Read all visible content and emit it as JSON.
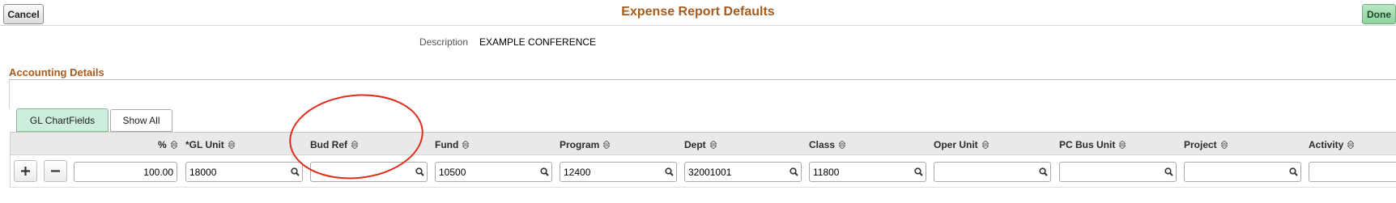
{
  "header": {
    "cancel_label": "Cancel",
    "title": "Expense Report Defaults",
    "done_label": "Done"
  },
  "description": {
    "label": "Description",
    "value": "EXAMPLE CONFERENCE"
  },
  "accounting": {
    "section_title": "Accounting Details",
    "tabs": [
      {
        "label": "GL ChartFields",
        "active": true
      },
      {
        "label": "Show All",
        "active": false
      }
    ],
    "columns": [
      "%",
      "*GL Unit",
      "Bud Ref",
      "Fund",
      "Program",
      "Dept",
      "Class",
      "Oper Unit",
      "PC Bus Unit",
      "Project",
      "Activity"
    ],
    "row": {
      "percent": "100.00",
      "gl_unit": "18000",
      "bud_ref": "",
      "fund": "10500",
      "program": "12400",
      "dept": "32001001",
      "class": "11800",
      "oper_unit": "",
      "pc_bus_unit": "",
      "project": "",
      "activity": ""
    },
    "row_actions": {
      "add_icon": "plus-icon",
      "delete_icon": "minus-icon"
    }
  },
  "colors": {
    "title_accent": "#a65b1f",
    "active_tab": "#cdeedd",
    "done_button": "#8fd3a0",
    "annotation": "#e02b1b"
  }
}
